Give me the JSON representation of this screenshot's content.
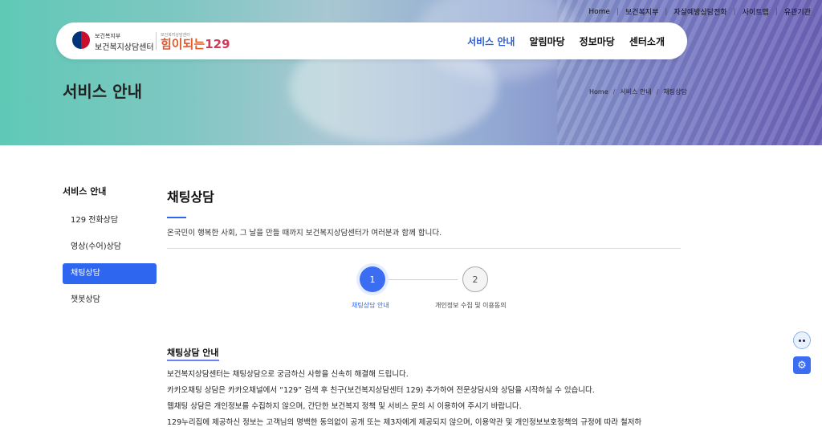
{
  "utility_nav": [
    "Home",
    "보건복지부",
    "자살예방상담전화",
    "사이트맵",
    "유관기관"
  ],
  "header": {
    "org_small": "보건복지부",
    "org_name": "보건복지상담센터",
    "brand_small": "보건복지상담센터",
    "brand_text": "힘이되는",
    "brand_num": "129"
  },
  "main_nav": [
    "서비스 안내",
    "알림마당",
    "정보마당",
    "센터소개"
  ],
  "page_title": "서비스 안내",
  "breadcrumb": [
    "Home",
    "서비스 안내",
    "채팅상담"
  ],
  "sidebar": {
    "title": "서비스 안내",
    "items": [
      "129 전화상담",
      "영상(수어)상담",
      "채팅상담",
      "챗봇상담"
    ],
    "active_index": 2
  },
  "content": {
    "title": "채팅상담",
    "desc": "온국민이 행복한 사회, 그 날을 만들 때까지 보건복지상담센터가 여러분과 함께 합니다.",
    "steps": [
      {
        "num": "1",
        "label": "채팅상담 안내"
      },
      {
        "num": "2",
        "label": "개인정보 수집 및 이용동의"
      }
    ],
    "section_title": "채팅상담 안내",
    "lines": [
      "보건복지상담센터는 채팅상담으로 궁금하신 사항을 신속히 해결해 드립니다.",
      "카카오채팅 상담은 카카오채널에서 “129” 검색 후 친구(보건복지상담센터 129) 추가하여 전문상담사와 상담을 시작하실 수 있습니다.",
      "웹채팅 상담은 개인정보를 수집하지 않으며, 간단한 보건복지 정책 및 서비스 문의 시 이용하여 주시기 바랍니다.",
      "129누리집에 제공하신 정보는 고객님의 명백한 동의없이 공개 또는 제3자에게 제공되지 않으며, 이용약관 및 개인정보보호정책의 규정에 따라 철저하"
    ]
  },
  "colors": {
    "accent": "#2f66f0",
    "brand": "#e05a2a"
  },
  "icons": {
    "mascot": "chatbot-mascot-icon",
    "settings": "gear-icon"
  }
}
